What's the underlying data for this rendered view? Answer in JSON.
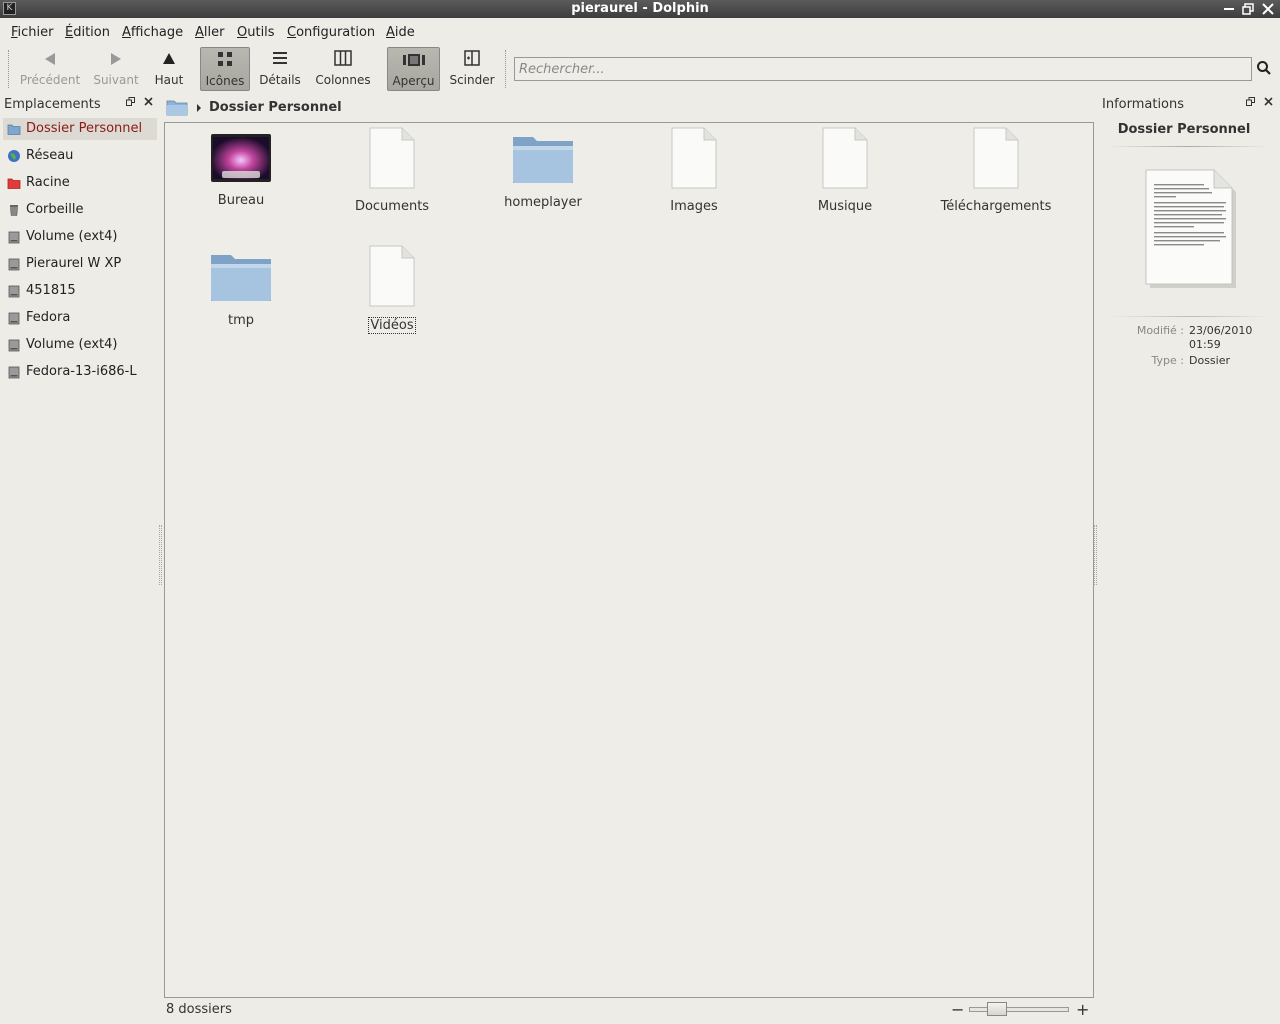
{
  "window": {
    "title": "pieraurel - Dolphin"
  },
  "menu": [
    {
      "mnemonic": "F",
      "rest": "ichier"
    },
    {
      "mnemonic": "É",
      "rest": "dition"
    },
    {
      "mnemonic": "A",
      "rest": "ffichage"
    },
    {
      "mnemonic": "A",
      "rest": "ller"
    },
    {
      "mnemonic": "O",
      "rest": "utils"
    },
    {
      "mnemonic": "C",
      "rest": "onfiguration"
    },
    {
      "mnemonic": "A",
      "rest": "ide"
    }
  ],
  "toolbar": {
    "back": "Précédent",
    "forward": "Suivant",
    "up": "Haut",
    "icons": "Icônes",
    "details": "Détails",
    "columns": "Colonnes",
    "preview": "Aperçu",
    "split": "Scinder",
    "search_placeholder": "Rechercher..."
  },
  "places": {
    "title": "Emplacements",
    "items": [
      {
        "label": "Dossier Personnel",
        "icon": "home-folder-icon",
        "selected": true
      },
      {
        "label": "Réseau",
        "icon": "network-globe-icon"
      },
      {
        "label": "Racine",
        "icon": "root-folder-icon"
      },
      {
        "label": "Corbeille",
        "icon": "trash-icon"
      },
      {
        "label": "Volume (ext4)",
        "icon": "drive-icon"
      },
      {
        "label": "Pieraurel W XP",
        "icon": "drive-icon"
      },
      {
        "label": "451815",
        "icon": "drive-icon"
      },
      {
        "label": "Fedora",
        "icon": "drive-icon"
      },
      {
        "label": "Volume (ext4)",
        "icon": "drive-icon"
      },
      {
        "label": "Fedora-13-i686-L",
        "icon": "drive-icon"
      }
    ]
  },
  "breadcrumb": {
    "current": "Dossier Personnel"
  },
  "files": [
    {
      "name": "Bureau",
      "icon": "desktop-folder-icon"
    },
    {
      "name": "Documents",
      "icon": "document-icon"
    },
    {
      "name": "homeplayer",
      "icon": "folder-icon"
    },
    {
      "name": "Images",
      "icon": "document-icon"
    },
    {
      "name": "Musique",
      "icon": "document-icon"
    },
    {
      "name": "Téléchargements",
      "icon": "document-icon"
    },
    {
      "name": "tmp",
      "icon": "folder-icon"
    },
    {
      "name": "Vidéos",
      "icon": "document-icon",
      "focused": true
    }
  ],
  "info": {
    "title": "Informations",
    "name": "Dossier Personnel",
    "modified_label": "Modifié :",
    "modified_date": "23/06/2010",
    "modified_time": "01:59",
    "type_label": "Type :",
    "type_value": "Dossier"
  },
  "status": {
    "text": "8 dossiers",
    "zoom_minus": "−",
    "zoom_plus": "+"
  }
}
